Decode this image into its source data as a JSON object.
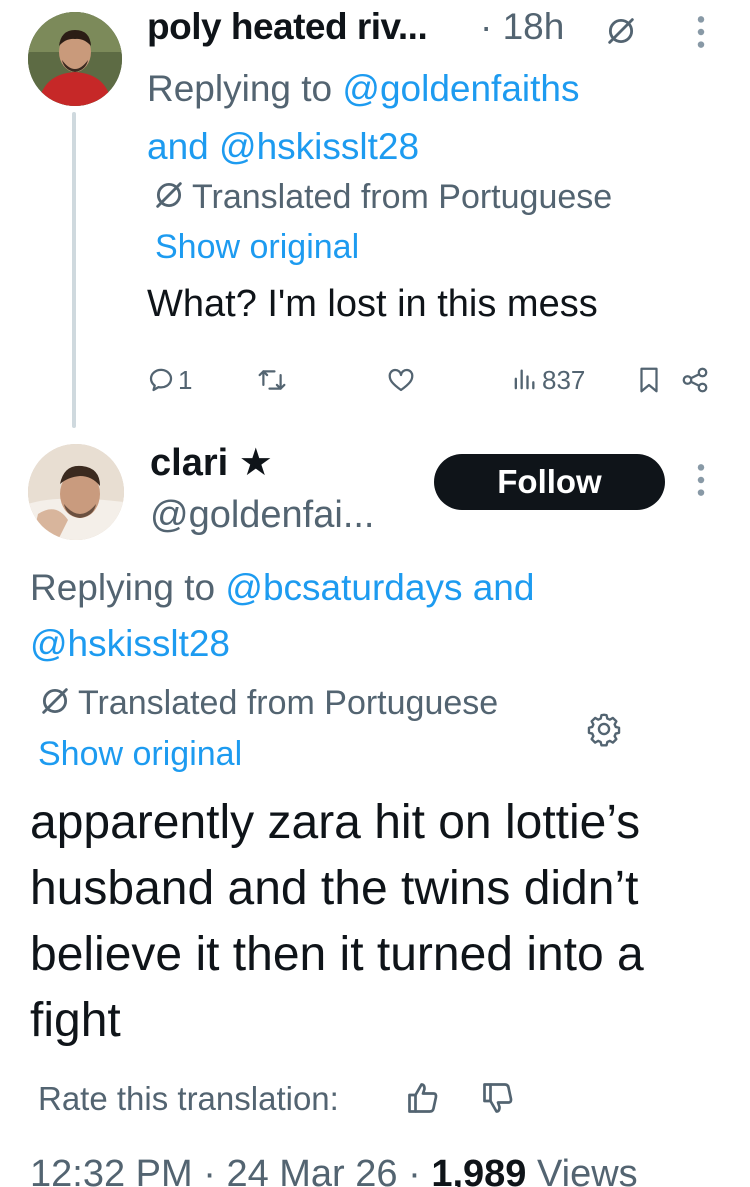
{
  "reply1": {
    "author_name": "poly heated riv...",
    "separator": "·",
    "time": "18h",
    "replying_prefix": "Replying to",
    "replying_user1": "@goldenfaiths",
    "replying_and": "and",
    "replying_user2": "@hskisslt28",
    "translated_label": "Translated from Portuguese",
    "show_original": "Show original",
    "text": "What? I'm lost in this mess",
    "reply_count": "1",
    "views": "837"
  },
  "reply2": {
    "author_name": "clari ★",
    "handle": "@goldenfai...",
    "follow_label": "Follow",
    "replying_prefix": "Replying to",
    "replying_user1": "@bcsaturdays",
    "replying_and": "and",
    "replying_user2": "@hskisslt28",
    "translated_label": "Translated from Portuguese",
    "show_original": "Show original",
    "text": "apparently zara hit on lottie’s husband and the twins didn’t believe it then it turned into a fight",
    "rate_label": "Rate this translation:",
    "footer_time": "12:32 PM",
    "footer_sep": "·",
    "footer_date": "24 Mar 26",
    "footer_views_count": "1,989",
    "footer_views_label": "Views"
  },
  "icons": {
    "translate": "globe-slash-icon",
    "more": "more-vertical-icon",
    "reply": "reply-icon",
    "retweet": "retweet-icon",
    "like": "heart-icon",
    "views": "views-bar-icon",
    "bookmark": "bookmark-icon",
    "share": "share-icon",
    "settings": "gear-icon",
    "thumbs_up": "thumbs-up-icon",
    "thumbs_down": "thumbs-down-icon"
  },
  "colors": {
    "link": "#1d9bf0",
    "secondary": "#536471",
    "primary": "#0f1419",
    "thread_line": "#cfd9de"
  }
}
